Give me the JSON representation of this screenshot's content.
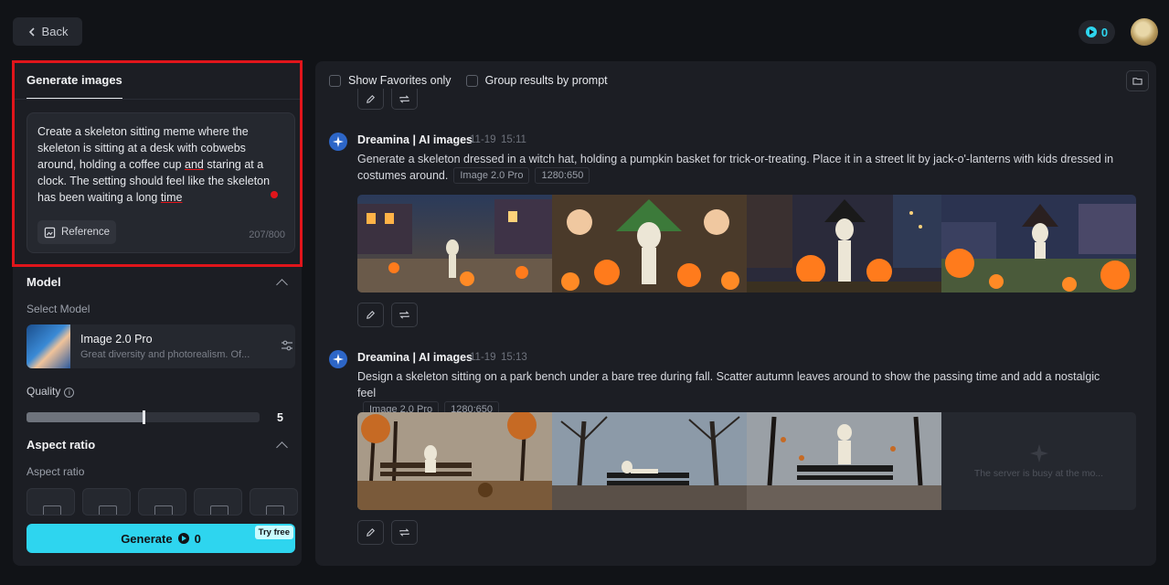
{
  "header": {
    "back_label": "Back",
    "credits": "0"
  },
  "left": {
    "tab_label": "Generate images",
    "prompt_before": "Create a skeleton sitting meme where the skeleton is sitting at a desk with cobwebs around, holding a coffee cup ",
    "prompt_and": "and",
    "prompt_middle": " staring at a clock. The setting should feel like the skeleton has been waiting a long ",
    "prompt_time": "time",
    "reference_label": "Reference",
    "char_count": "207/800",
    "model_section": "Model",
    "select_model_label": "Select Model",
    "model_name": "Image 2.0 Pro",
    "model_desc": "Great diversity and photorealism. Of...",
    "quality_label": "Quality",
    "quality_value": "5",
    "quality_fraction": 0.5,
    "aspect_section": "Aspect ratio",
    "aspect_label": "Aspect ratio",
    "generate_label": "Generate",
    "generate_credits": "0",
    "try_free": "Try free"
  },
  "right": {
    "show_favorites": "Show Favorites only",
    "group_results": "Group results by prompt",
    "generations": [
      {
        "author": "Dreamina | AI images",
        "date": "11-19",
        "time": "15:11",
        "prompt": "Generate a skeleton dressed in a witch hat, holding a pumpkin basket for trick-or-treating. Place it in a street lit by jack-o'-lanterns with kids dressed in costumes around.",
        "model_tag": "Image 2.0 Pro",
        "size_tag": "1280:650"
      },
      {
        "author": "Dreamina | AI images",
        "date": "11-19",
        "time": "15:13",
        "prompt": "Design a skeleton sitting on a park bench under a bare tree during fall. Scatter autumn leaves around to show the passing time and add a nostalgic feel",
        "model_tag": "Image 2.0 Pro",
        "size_tag": "1280:650",
        "busy_text": "The server is busy at the mo..."
      }
    ]
  }
}
